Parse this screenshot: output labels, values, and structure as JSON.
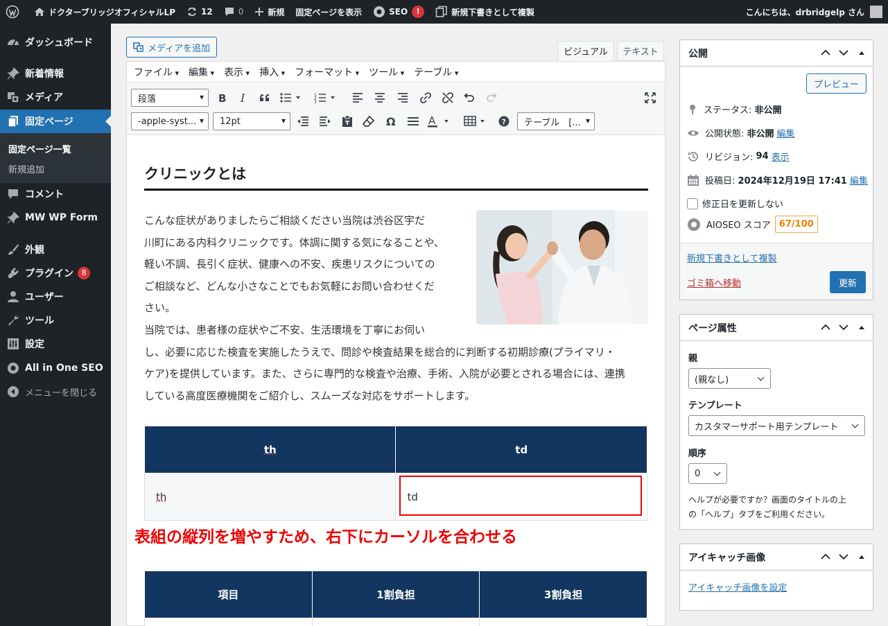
{
  "admin_bar": {
    "site_name": "ドクターブリッジオフィシャルLP",
    "updates_count": "12",
    "comments_count": "0",
    "new_label": "新規",
    "view_page_label": "固定ページを表示",
    "seo_label": "SEO",
    "seo_alert": "!",
    "duplicate_label": "新規下書きとして複製",
    "greeting": "こんにちは、drbridgelp さん"
  },
  "sidebar": {
    "dashboard": "ダッシュボード",
    "posts": "新着情報",
    "media": "メディア",
    "pages": "固定ページ",
    "pages_all": "固定ページ一覧",
    "pages_new": "新規追加",
    "comments": "コメント",
    "mwform": "MW WP Form",
    "appearance": "外観",
    "plugins": "プラグイン",
    "plugins_count": "8",
    "users": "ユーザー",
    "tools": "ツール",
    "settings": "設定",
    "aioseo": "All in One SEO",
    "collapse": "メニューを閉じる"
  },
  "editor": {
    "add_media": "メディアを追加",
    "tab_visual": "ビジュアル",
    "tab_text": "テキスト",
    "menubar": [
      "ファイル",
      "編集",
      "表示",
      "挿入",
      "フォーマット",
      "ツール",
      "テーブル"
    ],
    "format_select": "段落",
    "font_family_select": "-apple-syst...",
    "font_size_select": "12pt",
    "table_select": "テーブル　[..."
  },
  "content": {
    "heading": "クリニックとは",
    "para1_lines": [
      "こんな症状がありましたらご相談ください当院は渋谷区宇だ",
      "川町にある内科クリニックです。体調に関する気になることや、",
      "軽い不調、長引く症状、健康への不安、疾患リスクについての",
      "ご相談など、どんな小さなことでもお気軽にお問い合わせくだ",
      "さい。"
    ],
    "para2_lines": [
      "当院では、患者様の症状やご不安、生活環境を丁寧にお伺い",
      "し、必要に応じた検査を実施したうえで、問診や検査結果を総合的に判断する初期診療(プライマリ・",
      "ケア)を提供しています。また、さらに専門的な検査や治療、手術、入院が必要とされる場合には、連携",
      "している高度医療機関をご紹介し、スムーズな対応をサポートします。"
    ],
    "table1": {
      "headers": [
        "th",
        "td"
      ],
      "row": [
        "th",
        "td"
      ]
    },
    "annotation": "表組の縦列を増やすため、右下にカーソルを合わせる",
    "table2": {
      "headers": [
        "項目",
        "1割負担",
        "3割負担"
      ]
    }
  },
  "publish": {
    "title": "公開",
    "preview": "プレビュー",
    "status_label": "ステータス:",
    "status_value": "非公開",
    "visibility_label": "公開状態:",
    "visibility_value": "非公開",
    "visibility_edit": "編集",
    "revisions_label": "リビジョン:",
    "revisions_value": "94",
    "revisions_link": "表示",
    "date_label": "投稿日:",
    "date_value": "2024年12月19日 17:41",
    "date_edit": "編集",
    "no_modified_label": "修正日を更新しない",
    "aioseo_label": "AIOSEO スコア",
    "aioseo_score": "67/100",
    "duplicate_link": "新規下書きとして複製",
    "trash_link": "ゴミ箱へ移動",
    "update_button": "更新"
  },
  "page_attributes": {
    "title": "ページ属性",
    "parent_label": "親",
    "parent_value": "(親なし)",
    "template_label": "テンプレート",
    "template_value": "カスタマーサポート用テンプレート",
    "order_label": "順序",
    "order_value": "0",
    "help_line1": "ヘルプが必要ですか？画面のタイトルの上",
    "help_line2": "の「ヘルプ」タブをご利用ください。"
  },
  "featured_image": {
    "title": "アイキャッチ画像",
    "set_link": "アイキャッチ画像を設定"
  },
  "colors": {
    "wp_dark": "#1d2327",
    "wp_blue": "#2271b1",
    "table_header": "#12365f",
    "annotation_red": "#ee0000"
  }
}
